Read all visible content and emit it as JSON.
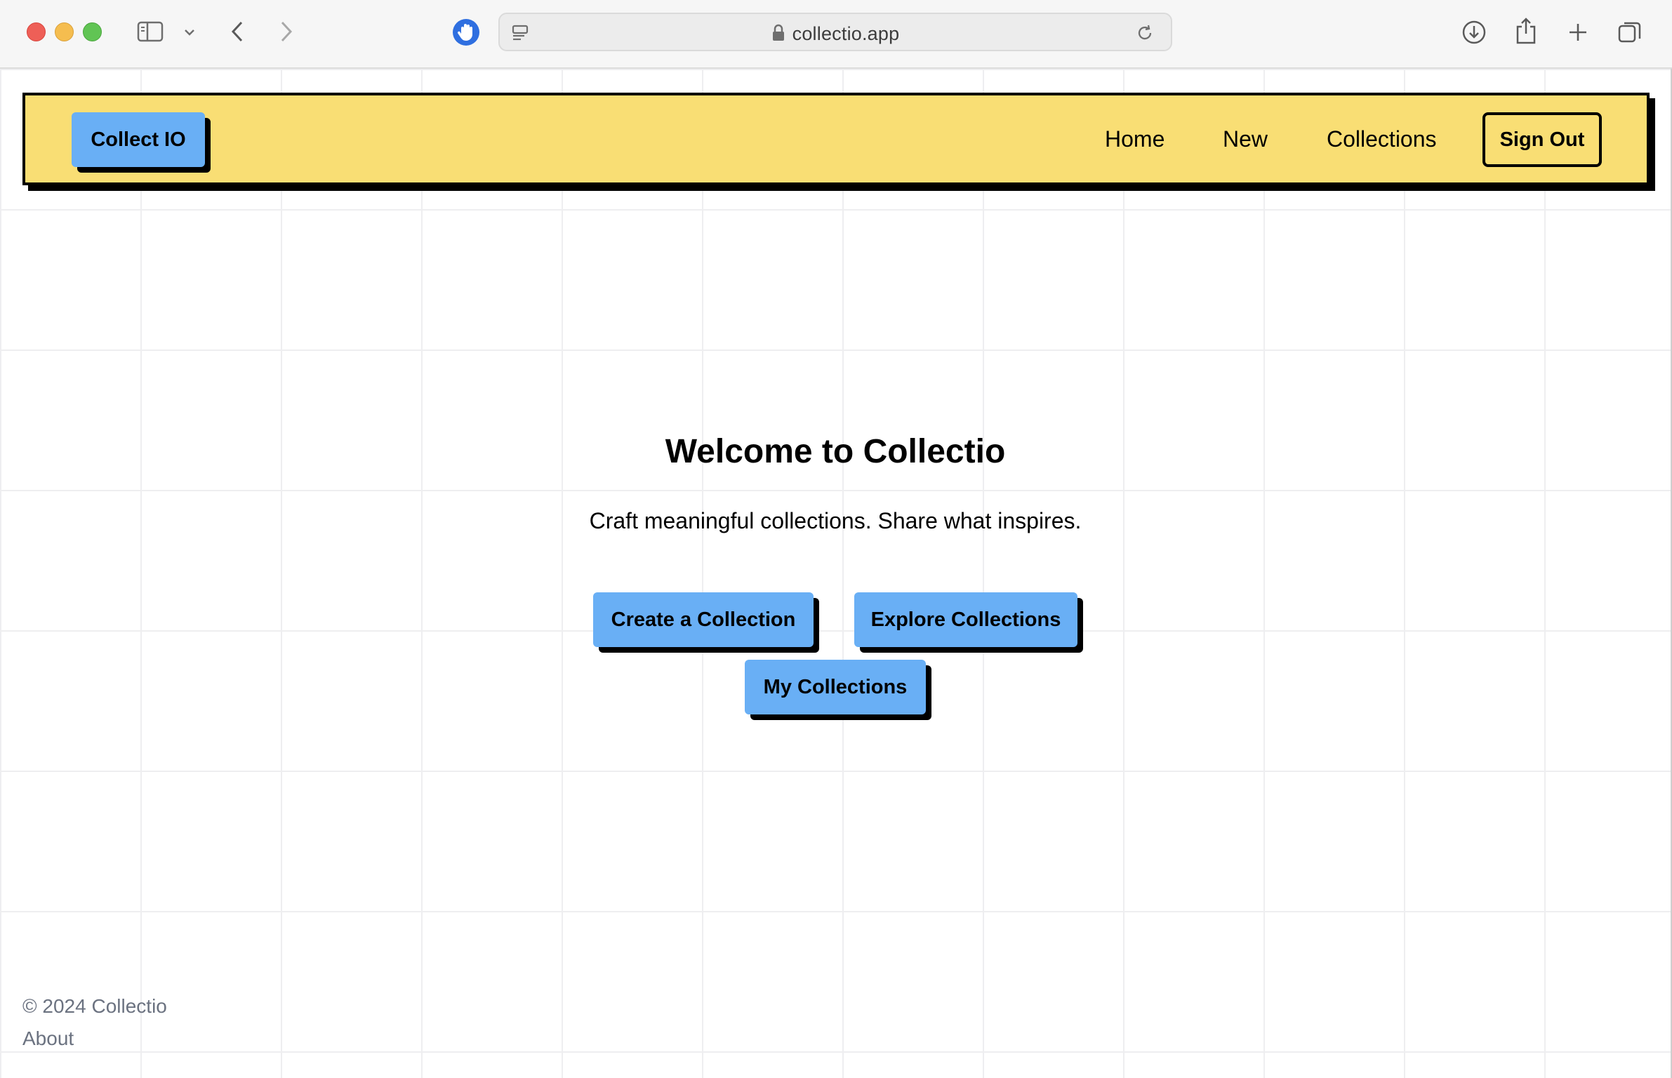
{
  "browser": {
    "url": "collectio.app",
    "icons": [
      "sidebar-icon",
      "chevron-down-icon",
      "back-icon",
      "forward-icon",
      "hand-shield-icon",
      "page-menu-icon",
      "lock-icon",
      "reload-icon",
      "download-icon",
      "share-icon",
      "new-tab-icon",
      "tabs-overview-icon"
    ]
  },
  "navbar": {
    "brand": "Collect IO",
    "links": [
      "Home",
      "New",
      "Collections"
    ],
    "sign_out": "Sign Out",
    "background": "#f9de74",
    "accent": "#69aff5"
  },
  "hero": {
    "title": "Welcome to Collectio",
    "subtitle": "Craft meaningful collections. Share what inspires.",
    "buttons": [
      "Create a Collection",
      "Explore Collections",
      "My Collections"
    ]
  },
  "footer": {
    "copyright": "© 2024 Collectio",
    "about": "About"
  }
}
